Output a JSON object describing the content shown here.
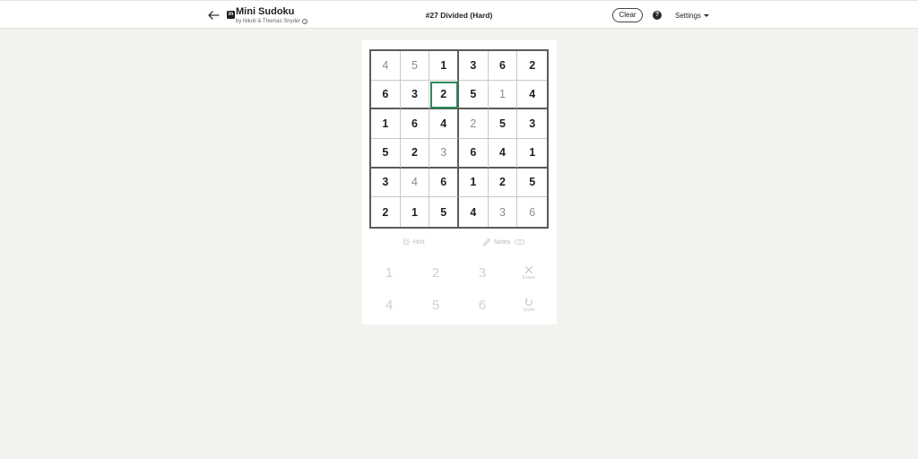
{
  "header": {
    "app_title": "Mini Sudoku",
    "byline": "by Nikoli & Thomas Snyder",
    "puzzle_title": "#27 Divided (Hard)",
    "clear_label": "Clear",
    "help_label": "?",
    "settings_label": "Settings",
    "brand_mark": "in"
  },
  "board": {
    "rows": [
      [
        {
          "v": "4",
          "t": "entered"
        },
        {
          "v": "5",
          "t": "entered"
        },
        {
          "v": "1",
          "t": "given"
        },
        {
          "v": "3",
          "t": "given"
        },
        {
          "v": "6",
          "t": "given"
        },
        {
          "v": "2",
          "t": "given"
        }
      ],
      [
        {
          "v": "6",
          "t": "given"
        },
        {
          "v": "3",
          "t": "given"
        },
        {
          "v": "2",
          "t": "given",
          "selected": true
        },
        {
          "v": "5",
          "t": "given"
        },
        {
          "v": "1",
          "t": "entered"
        },
        {
          "v": "4",
          "t": "given"
        }
      ],
      [
        {
          "v": "1",
          "t": "given"
        },
        {
          "v": "6",
          "t": "given"
        },
        {
          "v": "4",
          "t": "given"
        },
        {
          "v": "2",
          "t": "entered"
        },
        {
          "v": "5",
          "t": "given"
        },
        {
          "v": "3",
          "t": "given"
        }
      ],
      [
        {
          "v": "5",
          "t": "given"
        },
        {
          "v": "2",
          "t": "given"
        },
        {
          "v": "3",
          "t": "entered"
        },
        {
          "v": "6",
          "t": "given"
        },
        {
          "v": "4",
          "t": "given"
        },
        {
          "v": "1",
          "t": "given"
        }
      ],
      [
        {
          "v": "3",
          "t": "given"
        },
        {
          "v": "4",
          "t": "entered"
        },
        {
          "v": "6",
          "t": "given"
        },
        {
          "v": "1",
          "t": "given"
        },
        {
          "v": "2",
          "t": "given"
        },
        {
          "v": "5",
          "t": "given"
        }
      ],
      [
        {
          "v": "2",
          "t": "given"
        },
        {
          "v": "1",
          "t": "given"
        },
        {
          "v": "5",
          "t": "given"
        },
        {
          "v": "4",
          "t": "given"
        },
        {
          "v": "3",
          "t": "entered"
        },
        {
          "v": "6",
          "t": "entered"
        }
      ]
    ],
    "selected_color": "#2e8a57"
  },
  "tools": {
    "hint_label": "Hint",
    "notes_label": "Notes",
    "notes_toggle": "Off"
  },
  "keypad": {
    "digits": [
      "1",
      "2",
      "3",
      "4",
      "5",
      "6"
    ],
    "erase_label": "Erase",
    "undo_label": "Undo"
  }
}
